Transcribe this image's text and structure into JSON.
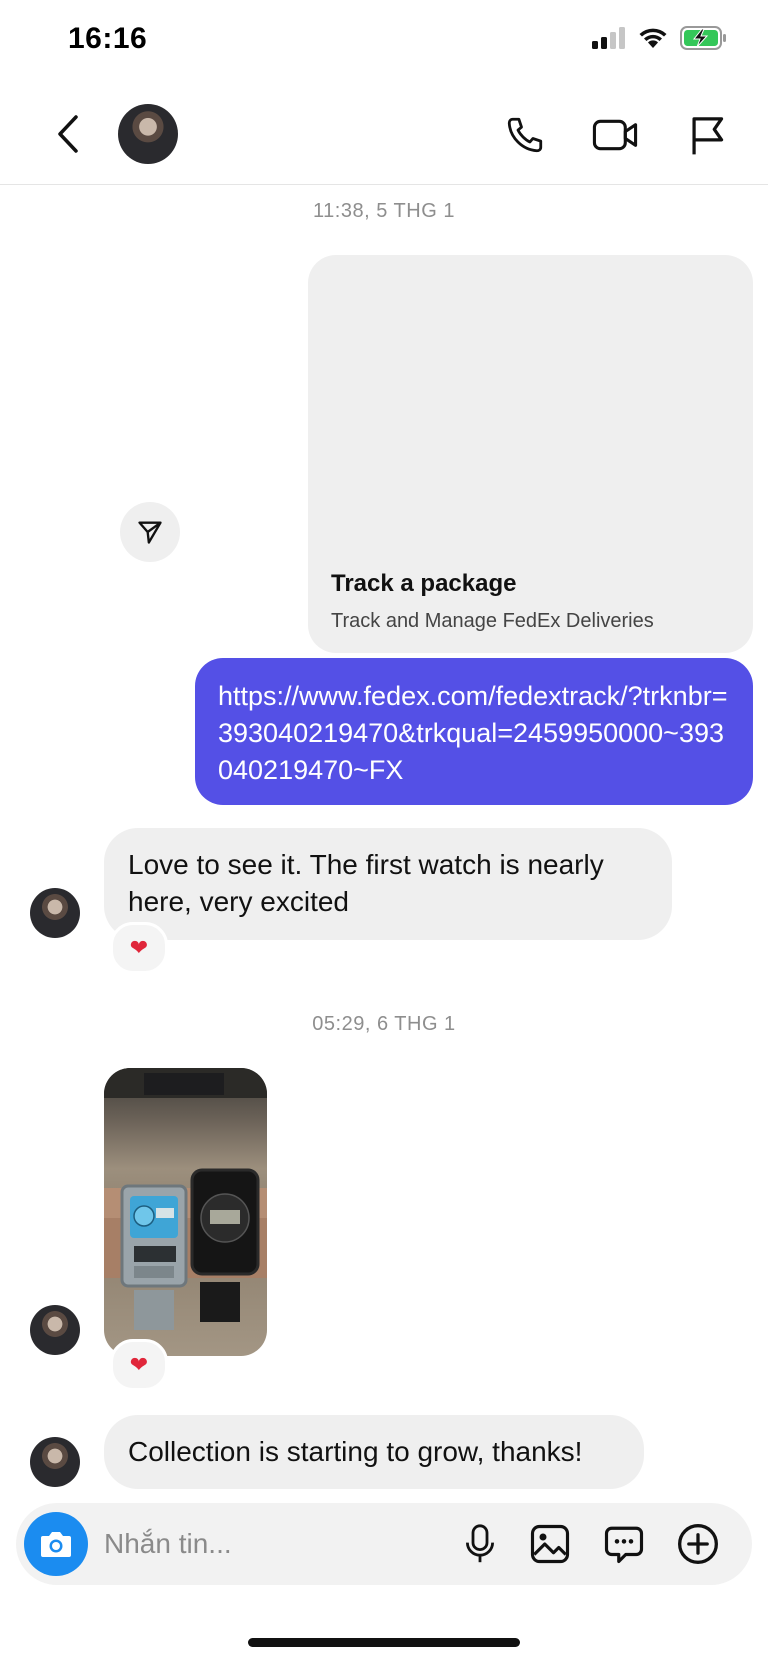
{
  "status_bar": {
    "time": "16:16",
    "signal_icon": "signal-icon",
    "wifi_icon": "wifi-icon",
    "battery_icon": "battery-charging-icon"
  },
  "header": {
    "back_icon": "chevron-left-icon",
    "call_icon": "phone-icon",
    "video_icon": "video-icon",
    "report_icon": "flag-icon"
  },
  "messages": {
    "timestamp_1": "11:38, 5 THG 1",
    "link_preview": {
      "title": "Track a package",
      "subtitle": "Track and Manage FedEx Deliveries"
    },
    "sent_link": "https://www.fedex.com/fedextrack/?trknbr=393040219470&trkqual=2459950000~393040219470~FX",
    "reply_1": "Love to see it. The first watch is nearly here, very excited",
    "reaction_1": "❤",
    "timestamp_2": "05:29, 6 THG 1",
    "reaction_2": "❤",
    "reply_3": "Collection is starting to grow, thanks!"
  },
  "composer": {
    "placeholder": "Nhắn tin...",
    "camera_icon": "camera-icon",
    "mic_icon": "microphone-icon",
    "gallery_icon": "image-icon",
    "sticker_icon": "chat-bubble-icon",
    "add_icon": "plus-circle-icon"
  },
  "colors": {
    "accent": "#5450e6",
    "camera": "#1b8cf0",
    "heart": "#e0263a"
  }
}
